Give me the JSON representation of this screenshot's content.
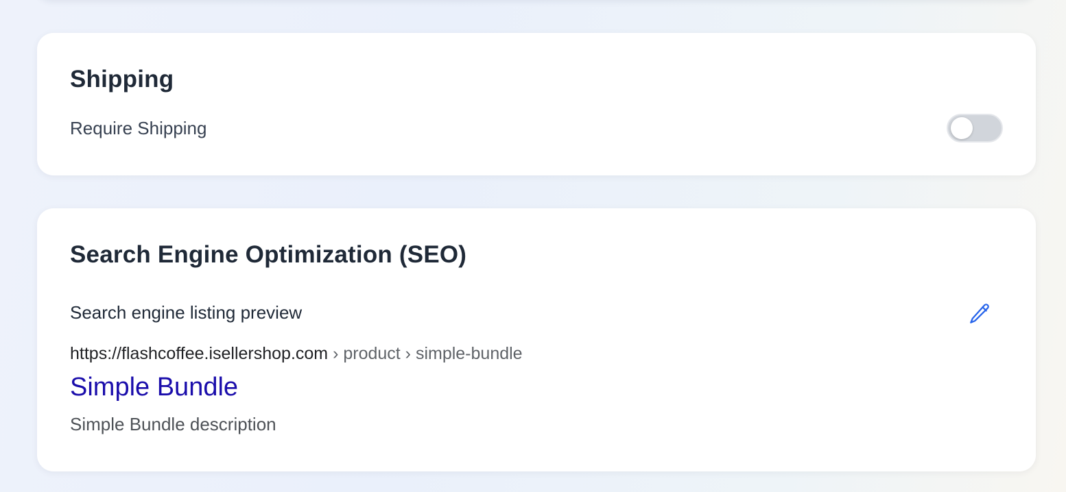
{
  "shipping": {
    "title": "Shipping",
    "require_shipping_label": "Require Shipping",
    "require_shipping_enabled": false
  },
  "seo": {
    "title": "Search Engine Optimization (SEO)",
    "preview_label": "Search engine listing preview",
    "edit_icon": "pencil-icon",
    "preview": {
      "url_domain": "https://flashcoffee.isellershop.com",
      "url_path": " › product › simple-bundle",
      "title": "Simple Bundle",
      "description": "Simple Bundle description"
    }
  },
  "colors": {
    "link_title": "#1a0dab",
    "edit_icon": "#2563eb",
    "toggle_off": "#d1d5db"
  }
}
